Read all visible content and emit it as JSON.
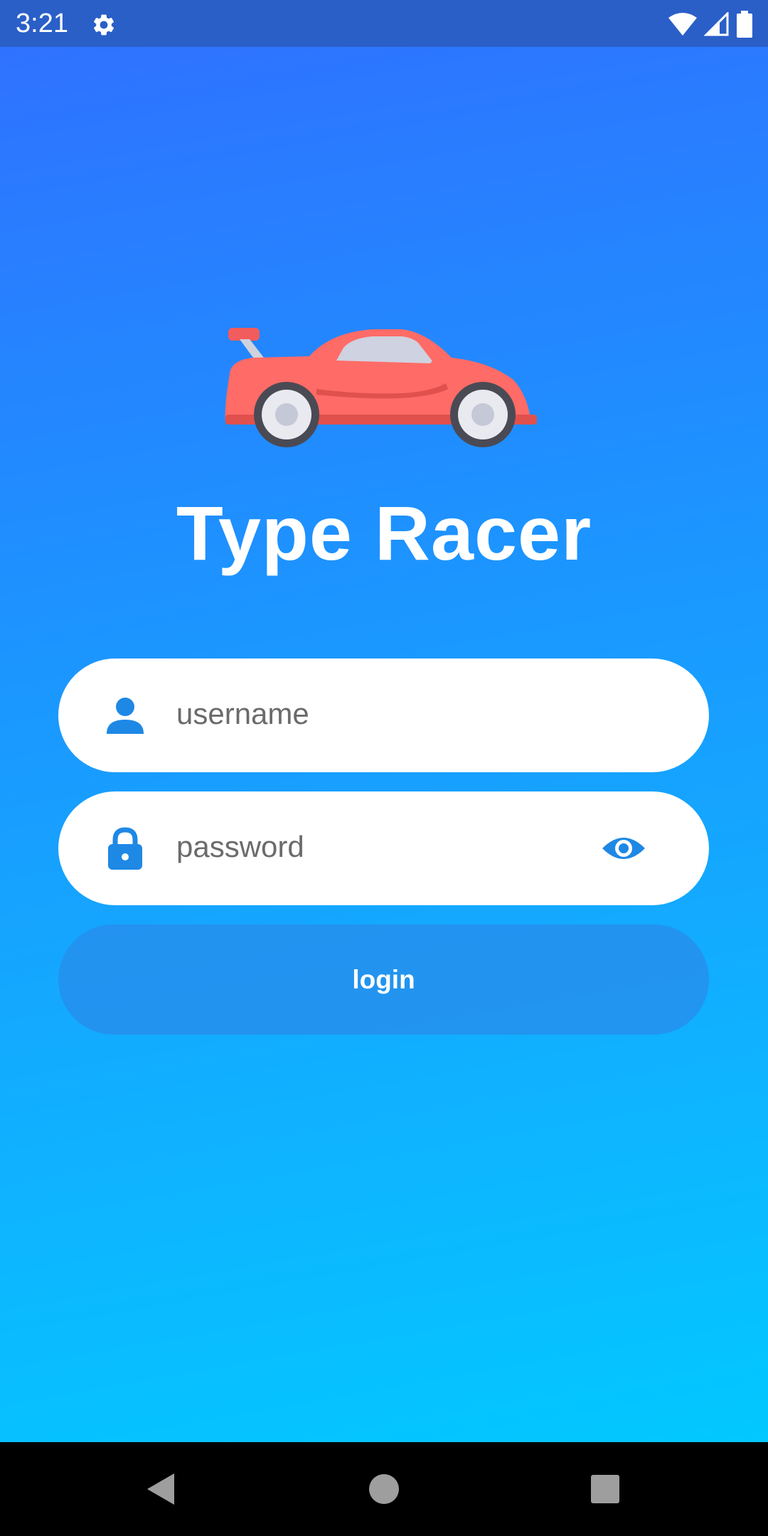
{
  "status_bar": {
    "time": "3:21",
    "icons": [
      "settings-gear-icon",
      "wifi-icon",
      "cell-signal-icon",
      "battery-icon"
    ]
  },
  "app": {
    "logo_icon": "race-car-icon",
    "title": "Type Racer"
  },
  "form": {
    "username": {
      "icon": "person-icon",
      "placeholder": "username",
      "value": ""
    },
    "password": {
      "icon": "lock-icon",
      "placeholder": "password",
      "value": "",
      "toggle_icon": "eye-icon"
    },
    "login_label": "login"
  },
  "nav_bar": {
    "icons": [
      "back-icon",
      "home-icon",
      "recents-icon"
    ]
  },
  "colors": {
    "status_bar": "#2a5fc8",
    "gradient_top": "#2f72ff",
    "gradient_bottom": "#02c8ff",
    "field_bg": "#ffffff",
    "icon_blue": "#1e88e5",
    "car_red": "#f25c5c"
  }
}
